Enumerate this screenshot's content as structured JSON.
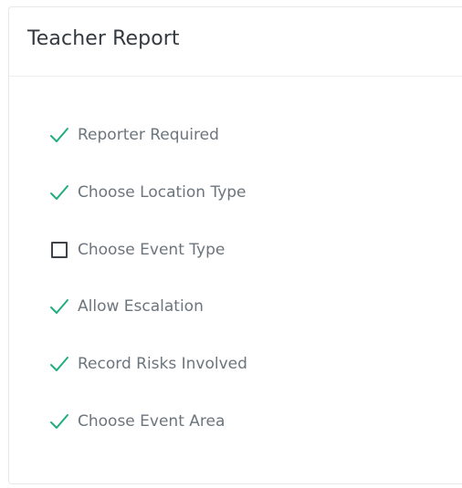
{
  "card": {
    "title": "Teacher Report"
  },
  "colors": {
    "check": "#1fae7a",
    "unchecked_box": "#3d4349",
    "label": "#6c757d",
    "title": "#343a40"
  },
  "features": [
    {
      "label": "Reporter Required",
      "enabled": true,
      "icon": "check-icon"
    },
    {
      "label": "Choose Location Type",
      "enabled": true,
      "icon": "check-icon"
    },
    {
      "label": "Choose Event Type",
      "enabled": false,
      "icon": "empty-checkbox-icon"
    },
    {
      "label": "Allow Escalation",
      "enabled": true,
      "icon": "check-icon"
    },
    {
      "label": "Record Risks Involved",
      "enabled": true,
      "icon": "check-icon"
    },
    {
      "label": "Choose Event Area",
      "enabled": true,
      "icon": "check-icon"
    }
  ]
}
